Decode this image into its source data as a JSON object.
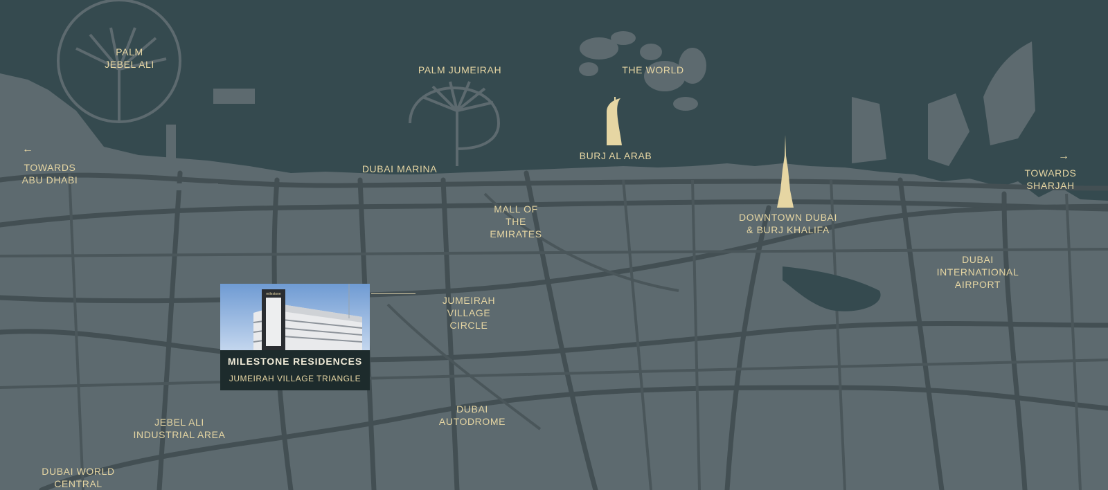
{
  "map": {
    "labels": {
      "palm_jebel_ali": "PALM\nJEBEL ALI",
      "palm_jumeirah": "PALM JUMEIRAH",
      "the_world": "THE WORLD",
      "burj_al_arab": "BURJ AL ARAB",
      "dubai_marina": "DUBAI MARINA",
      "towards_abu_dhabi": "TOWARDS\nABU DHABI",
      "towards_sharjah": "TOWARDS\nSHARJAH",
      "mall_of_the_emirates": "MALL OF\nTHE\nEMIRATES",
      "downtown_dubai": "DOWNTOWN DUBAI\n& BURJ KHALIFA",
      "dubai_international_airport": "DUBAI\nINTERNATIONAL\nAIRPORT",
      "jumeirah_village_circle": "JUMEIRAH\nVILLAGE\nCIRCLE",
      "dubai_autodrome": "DUBAI\nAUTODROME",
      "jebel_ali_industrial_area": "JEBEL ALI\nINDUSTRIAL AREA",
      "dubai_world_central": "DUBAI WORLD\nCENTRAL"
    },
    "arrows": {
      "left": "←",
      "right": "→"
    },
    "project": {
      "name": "MILESTONE RESIDENCES",
      "location": "JUMEIRAH VILLAGE TRIANGLE",
      "sign_text": "milestone"
    },
    "colors": {
      "sea": "#354a4f",
      "land": "#5d6a6f",
      "road": "#434f53",
      "label": "#e6d6a3",
      "card": "#1d2b2c"
    }
  }
}
